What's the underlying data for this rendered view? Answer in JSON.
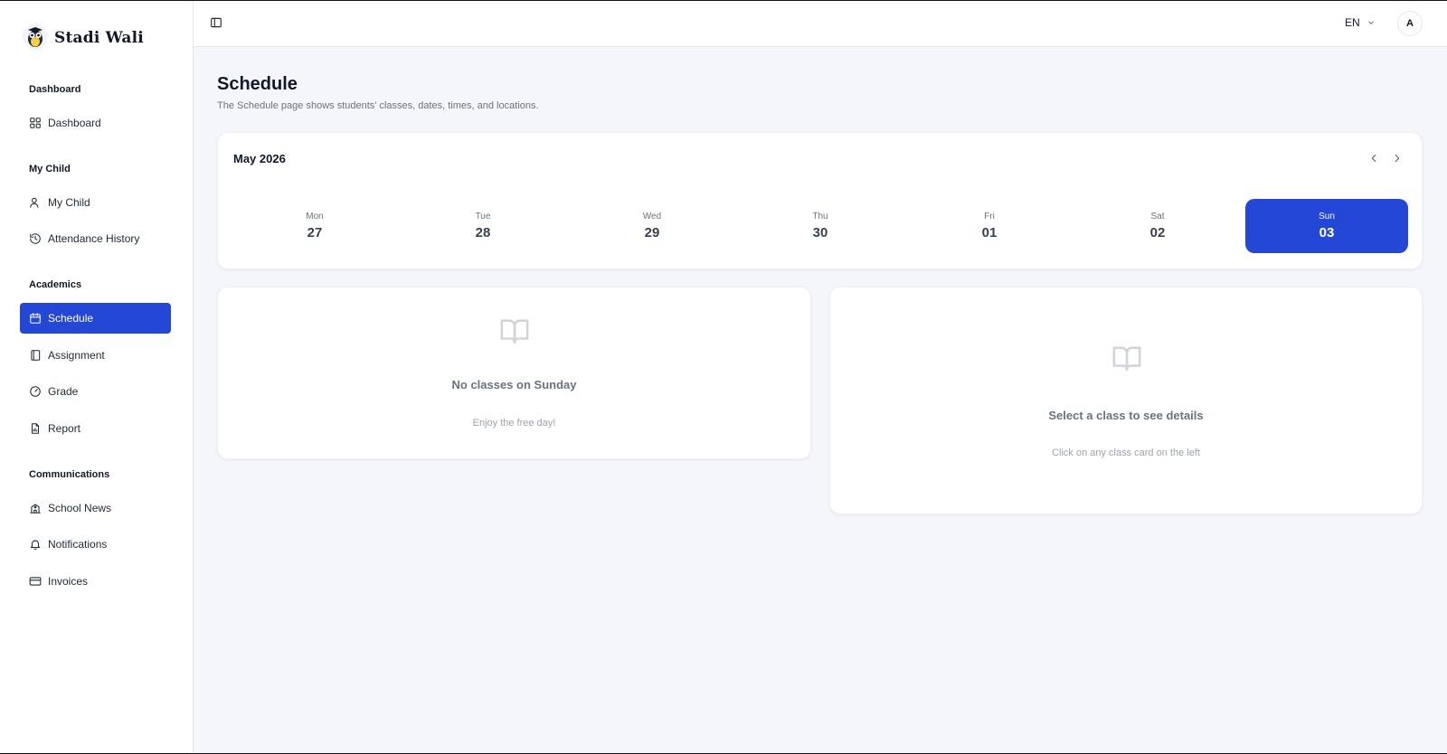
{
  "brand": {
    "name": "Stadi Wali"
  },
  "sidebar": {
    "sections": [
      {
        "label": "Dashboard",
        "items": [
          {
            "label": "Dashboard",
            "icon": "grid-icon"
          }
        ]
      },
      {
        "label": "My Child",
        "items": [
          {
            "label": "My Child",
            "icon": "user-icon"
          },
          {
            "label": "Attendance History",
            "icon": "history-icon"
          }
        ]
      },
      {
        "label": "Academics",
        "items": [
          {
            "label": "Schedule",
            "icon": "calendar-icon",
            "active": true
          },
          {
            "label": "Assignment",
            "icon": "notebook-icon"
          },
          {
            "label": "Grade",
            "icon": "gauge-icon"
          },
          {
            "label": "Report",
            "icon": "report-icon"
          }
        ]
      },
      {
        "label": "Communications",
        "items": [
          {
            "label": "School News",
            "icon": "school-icon"
          },
          {
            "label": "Notifications",
            "icon": "bell-icon"
          },
          {
            "label": "Invoices",
            "icon": "credit-card-icon"
          }
        ]
      }
    ]
  },
  "topbar": {
    "language": "EN",
    "avatar_initial": "A"
  },
  "page": {
    "title": "Schedule",
    "subtitle": "The Schedule page shows students' classes, dates, times, and locations."
  },
  "calendar": {
    "month_label": "May 2026",
    "days": [
      {
        "name": "Mon",
        "num": "27"
      },
      {
        "name": "Tue",
        "num": "28"
      },
      {
        "name": "Wed",
        "num": "29"
      },
      {
        "name": "Thu",
        "num": "30"
      },
      {
        "name": "Fri",
        "num": "01"
      },
      {
        "name": "Sat",
        "num": "02"
      },
      {
        "name": "Sun",
        "num": "03",
        "selected": true
      }
    ],
    "accent_color": "#2447d6"
  },
  "classes_panel": {
    "title": "No classes on Sunday",
    "subtitle": "Enjoy the free day!"
  },
  "details_panel": {
    "title": "Select a class to see details",
    "subtitle": "Click on any class card on the left"
  }
}
